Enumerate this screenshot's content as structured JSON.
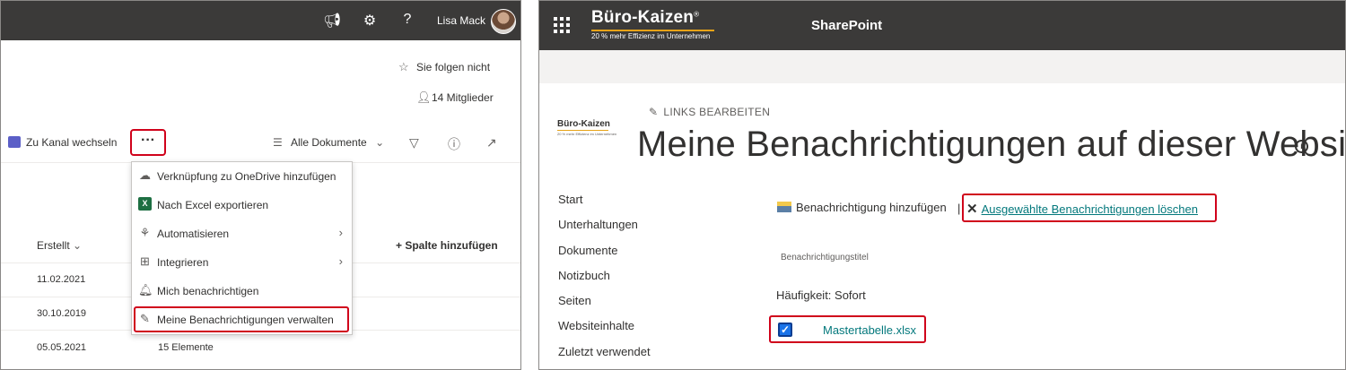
{
  "left": {
    "topbar": {
      "user_name": "Lisa Mack",
      "icons": [
        "megaphone-icon",
        "gear-icon",
        "help-icon"
      ]
    },
    "header": {
      "follow_label": "Sie folgen nicht",
      "members_label": "14 Mitglieder"
    },
    "toolbar": {
      "switch_channel_label": "Zu Kanal wechseln",
      "more_label": "···",
      "view_label": "Alle Dokumente"
    },
    "table": {
      "col_created": "Erstellt",
      "add_column": "+ Spalte hinzufügen",
      "rows": [
        {
          "date": "11.02.2021"
        },
        {
          "date": "30.10.2019"
        },
        {
          "date": "05.05.2021",
          "extra": "15 Elemente"
        }
      ]
    },
    "menu": {
      "items": [
        {
          "label": "Verknüpfung zu OneDrive hinzufügen",
          "icon": "onedrive-shortcut-icon"
        },
        {
          "label": "Nach Excel exportieren",
          "icon": "excel-icon"
        },
        {
          "label": "Automatisieren",
          "icon": "automate-icon"
        },
        {
          "label": "Integrieren",
          "icon": "integrate-icon"
        },
        {
          "label": "Mich benachrichtigen",
          "icon": "bell-icon"
        },
        {
          "label": "Meine Benachrichtigungen verwalten",
          "icon": "manage-alerts-icon"
        }
      ]
    }
  },
  "right": {
    "topbar": {
      "brand": "Büro-Kaizen",
      "brand_mark": "®",
      "tagline": "20 % mehr Effizienz im Unternehmen",
      "app_title": "SharePoint"
    },
    "site_logo": {
      "brand": "Büro-Kaizen",
      "tagline": "20 % mehr Effizienz im Unternehmen"
    },
    "edit_links": "LINKS BEARBEITEN",
    "page_title": "Meine Benachrichtigungen auf dieser Website",
    "nav": [
      "Start",
      "Unterhaltungen",
      "Dokumente",
      "Notizbuch",
      "Seiten",
      "Websiteinhalte",
      "Zuletzt verwendet"
    ],
    "actions": {
      "add_alert": "Benachrichtigung hinzufügen",
      "separator": "|",
      "delete_selected": "Ausgewählte Benachrichtigungen löschen"
    },
    "list": {
      "column_title": "Benachrichtigungstitel",
      "frequency": "Häufigkeit: Sofort",
      "item_file": "Mastertabelle.xlsx",
      "item_checked": true
    },
    "colors": {
      "topbar": "#3b3a39",
      "highlight": "#d0021b",
      "link": "#03787c",
      "brand_accent": "#e8a317"
    }
  }
}
